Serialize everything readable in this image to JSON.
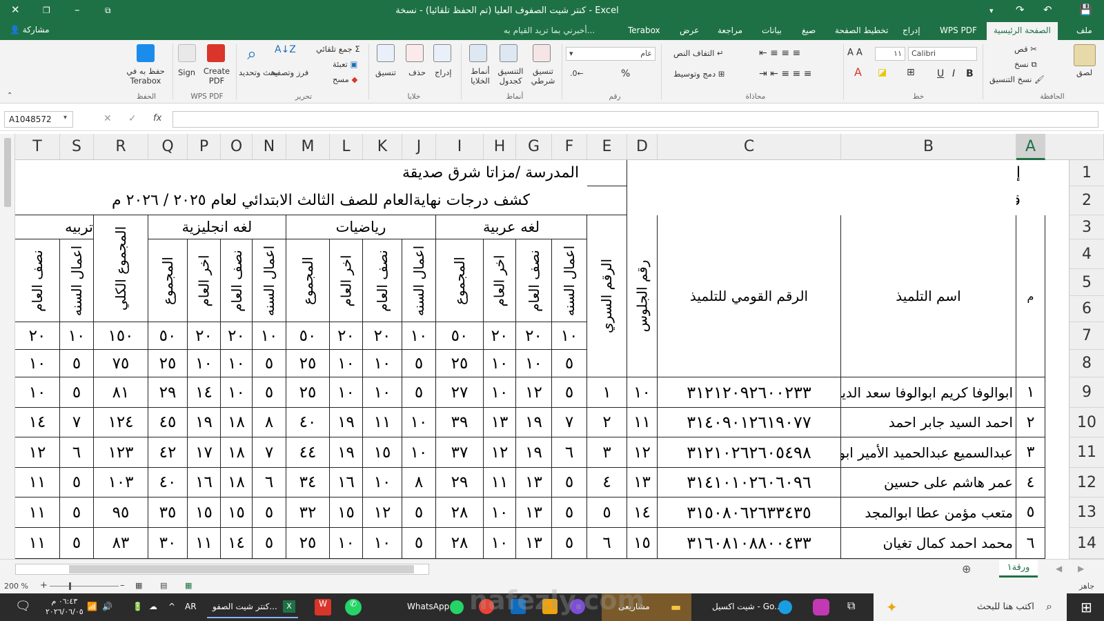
{
  "window": {
    "title": "كنتر شيت الصفوف العليا (تم الحفظ تلقائيا) - نسخة - Excel",
    "share": "مشاركة"
  },
  "tabs": [
    "ملف",
    "الصفحة الرئيسية",
    "WPS PDF",
    "إدراج",
    "تخطيط الصفحة",
    "صيغ",
    "بيانات",
    "مراجعة",
    "عرض",
    "Terabox"
  ],
  "tell_me": "أخبرني بما تريد القيام به...",
  "ribbon": {
    "clipboard": {
      "group": "الحافظة",
      "paste": "لصق",
      "cut": "قص",
      "copy": "نسخ",
      "format_painter": "نسخ التنسيق"
    },
    "font": {
      "group": "خط",
      "name": "Calibri",
      "size": "١١",
      "bold": "B",
      "italic": "I",
      "underline": "U"
    },
    "alignment": {
      "group": "محاذاة",
      "wrap": "التفاف النص",
      "merge": "دمج وتوسيط"
    },
    "number": {
      "group": "رقم",
      "format": "عام",
      "percent": "%"
    },
    "styles": {
      "group": "أنماط",
      "conditional": "تنسيق شرطي",
      "as_table": "التنسيق كجدول",
      "cell_styles": "أنماط الخلايا"
    },
    "cells": {
      "group": "خلايا",
      "insert": "إدراج",
      "delete": "حذف",
      "format": "تنسيق"
    },
    "editing": {
      "group": "تحرير",
      "autosum": "جمع تلقائي",
      "fill": "تعبئة",
      "clear": "مسح",
      "sort": "فرز وتصفية",
      "find": "بحث وتحديد"
    },
    "wps": {
      "group": "WPS PDF",
      "create": "Create PDF",
      "sign": "Sign"
    },
    "terabox": {
      "group": "الحفظ",
      "save": "حفظ به في Terabox"
    }
  },
  "formula_bar": {
    "name_box": "A1048572",
    "fx": "fx"
  },
  "columns": [
    "A",
    "B",
    "C",
    "D",
    "E",
    "F",
    "G",
    "H",
    "I",
    "J",
    "K",
    "L",
    "M",
    "N",
    "O",
    "P",
    "Q",
    "R",
    "S",
    "T"
  ],
  "rows": [
    "1",
    "2",
    "3",
    "4",
    "5",
    "6",
    "7",
    "8",
    "9",
    "10",
    "11",
    "12",
    "13",
    "14"
  ],
  "sheet": {
    "admin": "إدارة دارالسلام التعليمية",
    "dept": "قسم التعليم المجتمعي",
    "school": "المدرسة  /مزاتا شرق صديقة",
    "report_title": "كشف درجات نهايةالعام للصف الثالث الابتدائي لعام ٢٠٢٥ / ٢٠٢٦ م",
    "headers": {
      "m": "م",
      "name": "اسم التلميذ",
      "national": "الرقم القومي للتلميذ",
      "seat": "رقم الجلوس",
      "secret": "الرقم السري",
      "arabic": "لغه عربية",
      "math": "رياضيات",
      "english": "لغه انجليزية",
      "total": "المجموع الكلي",
      "religion": "تربيه"
    },
    "subheaders": {
      "year_work": "اعمال السنه",
      "mid": "نصف العام",
      "end": "اخر العام",
      "sum": "المجموع"
    },
    "max_row": {
      "ar": [
        "١٠",
        "٢٠",
        "٢٠",
        "٥٠"
      ],
      "ma": [
        "١٠",
        "٢٠",
        "٢٠",
        "٥٠"
      ],
      "en": [
        "١٠",
        "٢٠",
        "٢٠",
        "٥٠"
      ],
      "total": "١٥٠",
      "rel": [
        "١٠",
        "٢٠"
      ]
    },
    "min_row": {
      "ar": [
        "٥",
        "١٠",
        "١٠",
        "٢٥"
      ],
      "ma": [
        "٥",
        "١٠",
        "١٠",
        "٢٥"
      ],
      "en": [
        "٥",
        "١٠",
        "١٠",
        "٢٥"
      ],
      "total": "٧٥",
      "rel": [
        "٥",
        "١٠"
      ]
    },
    "students": [
      {
        "m": "١",
        "name": "ابوالوفا كريم ابوالوفا سعد الدين",
        "nid": "٣١٢١٢٠٩٢٦٠٠٢٣٣",
        "seat": "١٠",
        "secret": "١",
        "ar": [
          "٥",
          "١٢",
          "١٠",
          "٢٧"
        ],
        "ma": [
          "٥",
          "١٠",
          "١٠",
          "٢٥"
        ],
        "en": [
          "٥",
          "١٠",
          "١٤",
          "٢٩"
        ],
        "total": "٨١",
        "rel": [
          "٥",
          "١٠"
        ]
      },
      {
        "m": "٢",
        "name": "احمد السيد جابر احمد",
        "nid": "٣١٤٠٩٠١٢٦١٩٠٧٧",
        "seat": "١١",
        "secret": "٢",
        "ar": [
          "٧",
          "١٩",
          "١٣",
          "٣٩"
        ],
        "ma": [
          "١٠",
          "١١",
          "١٩",
          "٤٠"
        ],
        "en": [
          "٨",
          "١٨",
          "١٩",
          "٤٥"
        ],
        "total": "١٢٤",
        "rel": [
          "٧",
          "١٤"
        ]
      },
      {
        "m": "٣",
        "name": "عبدالسميع عبدالحميد الأمير ابو",
        "nid": "٣١٢١٠٢٦٢٦٠٥٤٩٨",
        "seat": "١٢",
        "secret": "٣",
        "ar": [
          "٦",
          "١٩",
          "١٢",
          "٣٧"
        ],
        "ma": [
          "١٠",
          "١٥",
          "١٩",
          "٤٤"
        ],
        "en": [
          "٧",
          "١٨",
          "١٧",
          "٤٢"
        ],
        "total": "١٢٣",
        "rel": [
          "٦",
          "١٢"
        ]
      },
      {
        "m": "٤",
        "name": "عمر هاشم على حسين",
        "nid": "٣١٤١٠١٠٢٦٠٦٠٩٦",
        "seat": "١٣",
        "secret": "٤",
        "ar": [
          "٥",
          "١٣",
          "١١",
          "٢٩"
        ],
        "ma": [
          "٨",
          "١٠",
          "١٦",
          "٣٤"
        ],
        "en": [
          "٦",
          "١٨",
          "١٦",
          "٤٠"
        ],
        "total": "١٠٣",
        "rel": [
          "٥",
          "١١"
        ]
      },
      {
        "m": "٥",
        "name": "متعب مؤمن عطا ابوالمجد",
        "nid": "٣١٥٠٨٠٦٢٦٣٣٤٣٥",
        "seat": "١٤",
        "secret": "٥",
        "ar": [
          "٥",
          "١٣",
          "١٠",
          "٢٨"
        ],
        "ma": [
          "٥",
          "١٢",
          "١٥",
          "٣٢"
        ],
        "en": [
          "٥",
          "١٥",
          "١٥",
          "٣٥"
        ],
        "total": "٩٥",
        "rel": [
          "٥",
          "١١"
        ]
      },
      {
        "m": "٦",
        "name": "محمد احمد كمال تغيان",
        "nid": "٣١٦٠٨١٠٨٨٠٠٤٣٣",
        "seat": "١٥",
        "secret": "٦",
        "ar": [
          "٥",
          "١٣",
          "١٠",
          "٢٨"
        ],
        "ma": [
          "٥",
          "١٠",
          "١٠",
          "٢٥"
        ],
        "en": [
          "٥",
          "١٤",
          "١١",
          "٣٠"
        ],
        "total": "٨٣",
        "rel": [
          "٥",
          "١١"
        ]
      }
    ]
  },
  "sheet_tab": "ورقة١",
  "status": {
    "ready": "جاهز",
    "zoom": "200 %"
  },
  "taskbar": {
    "search": "اكتب هنا للبحث",
    "edge": "شيت اكسيل - Go...",
    "folder": "مشاريعى",
    "whatsapp": "WhatsApp",
    "excel": "كنتر شيت الصفو...",
    "lang": "AR",
    "time": "٠٦:٤٣ م",
    "date": "٢٠٢٦/٠٦/٠٥"
  },
  "watermark": "nafezly.com"
}
